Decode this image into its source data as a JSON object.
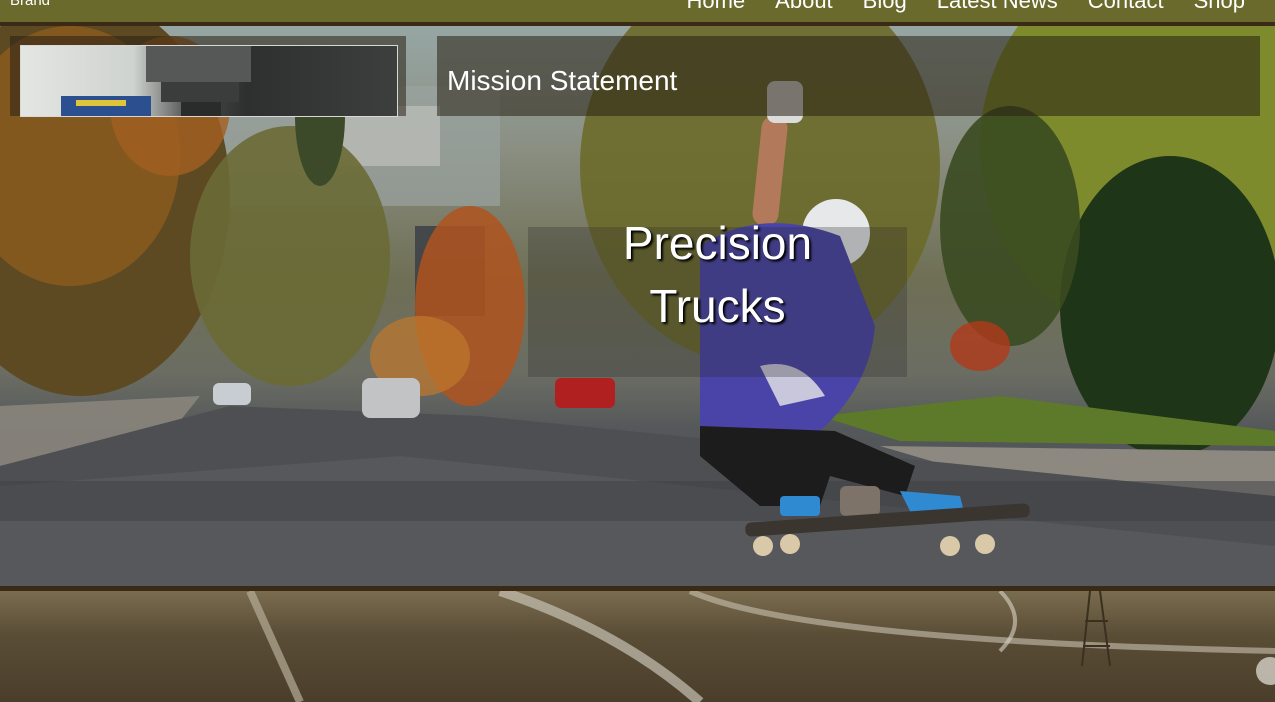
{
  "nav": {
    "brand": "Brand",
    "items": [
      {
        "label": "Home"
      },
      {
        "label": "About"
      },
      {
        "label": "Blog"
      },
      {
        "label": "Latest News"
      },
      {
        "label": "Contact"
      },
      {
        "label": "Shop"
      }
    ]
  },
  "hero": {
    "title_line1": "Precision",
    "title_line2": "Trucks"
  },
  "mission": {
    "title": "Mission Statement"
  },
  "colors": {
    "navbar": "#6a6a2c",
    "border": "#3b2a15",
    "text": "#ffffff"
  }
}
